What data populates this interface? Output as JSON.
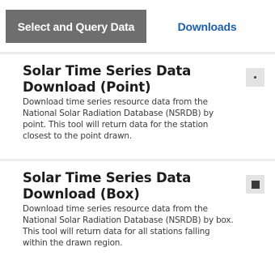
{
  "tabs": {
    "select_query": "Select and Query Data",
    "downloads": "Downloads"
  },
  "cards": [
    {
      "title_line1": "Solar Time Series Data",
      "title_line2": "Download (Point)",
      "desc_lines": [
        "Download time series resource data from the",
        "National Solar Radiation Database (NSRDB) by",
        "point. This tool will return data for the station",
        "closest to the point drawn."
      ],
      "button_icon": "point-icon"
    },
    {
      "title_line1": "Solar Time Series Data",
      "title_line2": "Download (Box)",
      "desc_lines": [
        "Download time series resource data from the",
        "National Solar Radiation Database (NSRDB) by box.",
        "This tool will return data for all stations falling",
        "within the drawn region."
      ],
      "button_icon": "box-icon"
    }
  ]
}
